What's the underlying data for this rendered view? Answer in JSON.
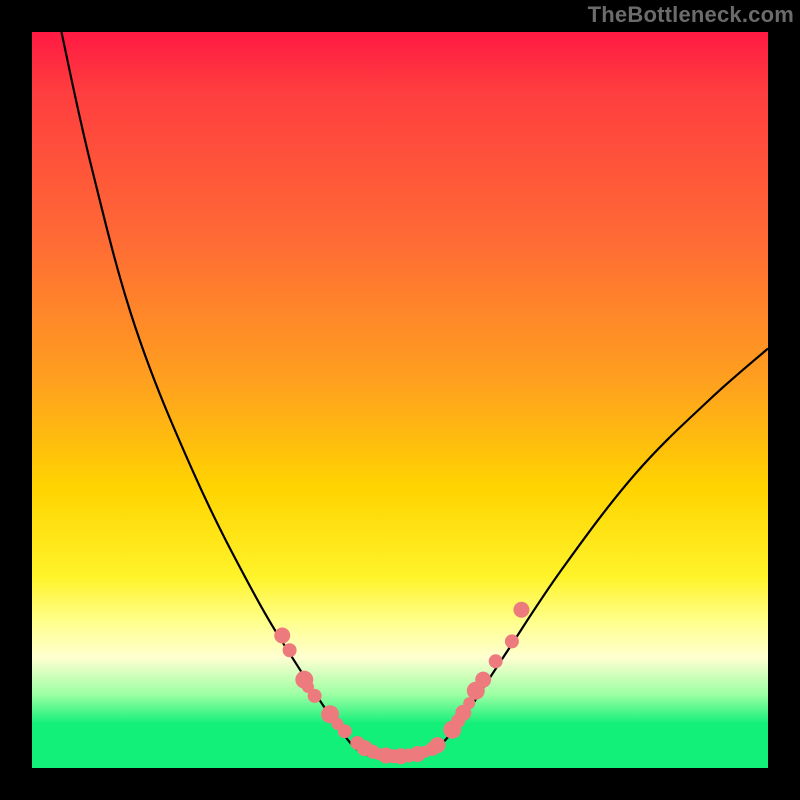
{
  "watermark": "TheBottleneck.com",
  "colors": {
    "frame": "#000000",
    "curve": "#000000",
    "marker": "#ed7b7e",
    "gradient_top": "#ff1a43",
    "gradient_bottom": "#13f07a"
  },
  "chart_data": {
    "type": "line",
    "title": "",
    "xlabel": "",
    "ylabel": "",
    "xlim": [
      0,
      100
    ],
    "ylim": [
      0,
      100
    ],
    "curve_left": [
      {
        "x": 4,
        "y": 100
      },
      {
        "x": 8,
        "y": 82
      },
      {
        "x": 14,
        "y": 60
      },
      {
        "x": 22,
        "y": 40
      },
      {
        "x": 30,
        "y": 24
      },
      {
        "x": 36,
        "y": 14
      },
      {
        "x": 42,
        "y": 5
      },
      {
        "x": 45,
        "y": 2
      }
    ],
    "curve_bottom": [
      {
        "x": 45,
        "y": 2
      },
      {
        "x": 48,
        "y": 1.5
      },
      {
        "x": 51,
        "y": 1.5
      },
      {
        "x": 54,
        "y": 2
      }
    ],
    "curve_right": [
      {
        "x": 54,
        "y": 2
      },
      {
        "x": 58,
        "y": 6
      },
      {
        "x": 64,
        "y": 15
      },
      {
        "x": 72,
        "y": 27
      },
      {
        "x": 82,
        "y": 40
      },
      {
        "x": 92,
        "y": 50
      },
      {
        "x": 100,
        "y": 57
      }
    ],
    "markers": [
      {
        "x": 34,
        "y": 18,
        "r": 8
      },
      {
        "x": 35,
        "y": 16,
        "r": 7
      },
      {
        "x": 37,
        "y": 12,
        "r": 9
      },
      {
        "x": 37.5,
        "y": 11,
        "r": 6
      },
      {
        "x": 38.4,
        "y": 9.8,
        "r": 7
      },
      {
        "x": 40.5,
        "y": 7.3,
        "r": 9
      },
      {
        "x": 41.5,
        "y": 6.0,
        "r": 6
      },
      {
        "x": 42.5,
        "y": 5.0,
        "r": 7
      },
      {
        "x": 44.2,
        "y": 3.4,
        "r": 7
      },
      {
        "x": 45.2,
        "y": 2.7,
        "r": 8
      },
      {
        "x": 46.3,
        "y": 2.2,
        "r": 7
      },
      {
        "x": 47.1,
        "y": 1.9,
        "r": 6
      },
      {
        "x": 48.1,
        "y": 1.7,
        "r": 8
      },
      {
        "x": 49.1,
        "y": 1.6,
        "r": 7
      },
      {
        "x": 50.1,
        "y": 1.6,
        "r": 8
      },
      {
        "x": 51.2,
        "y": 1.7,
        "r": 7
      },
      {
        "x": 52.4,
        "y": 1.9,
        "r": 8
      },
      {
        "x": 53.4,
        "y": 2.2,
        "r": 6
      },
      {
        "x": 54.4,
        "y": 2.6,
        "r": 7
      },
      {
        "x": 55.1,
        "y": 3.1,
        "r": 8
      },
      {
        "x": 57.1,
        "y": 5.2,
        "r": 9
      },
      {
        "x": 57.9,
        "y": 6.4,
        "r": 7
      },
      {
        "x": 58.6,
        "y": 7.5,
        "r": 8
      },
      {
        "x": 59.4,
        "y": 8.8,
        "r": 6
      },
      {
        "x": 60.3,
        "y": 10.5,
        "r": 9
      },
      {
        "x": 61.3,
        "y": 12.0,
        "r": 8
      },
      {
        "x": 63.0,
        "y": 14.5,
        "r": 7
      },
      {
        "x": 65.2,
        "y": 17.2,
        "r": 7
      },
      {
        "x": 66.5,
        "y": 21.5,
        "r": 8
      }
    ]
  }
}
